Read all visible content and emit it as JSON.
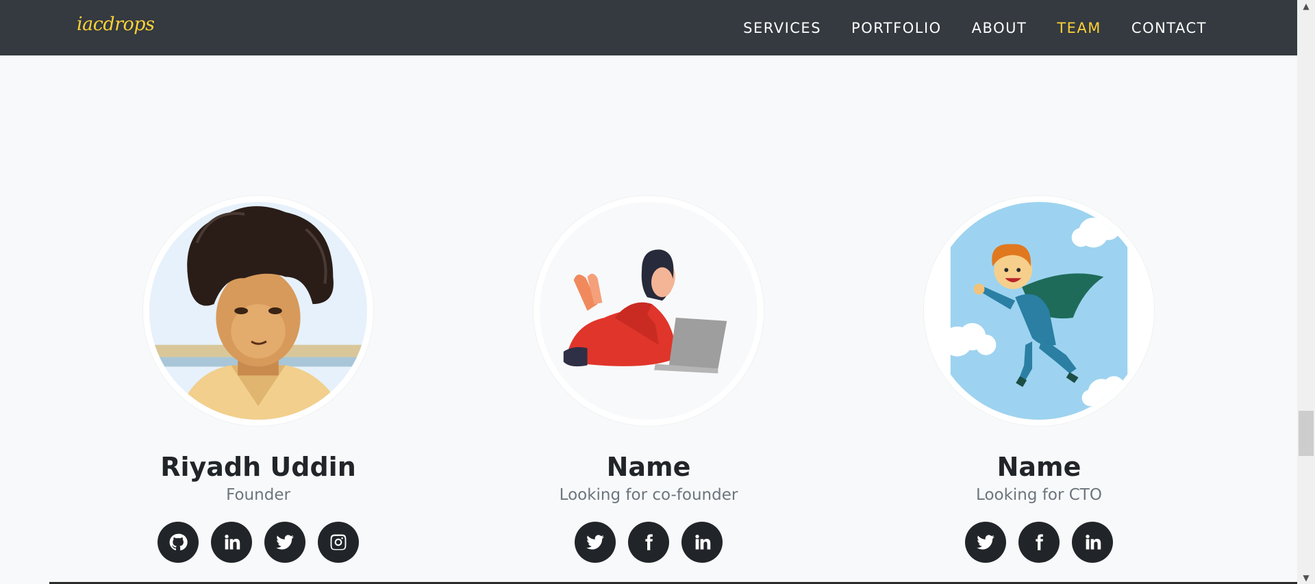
{
  "navbar": {
    "brand": "iacdrops",
    "items": [
      {
        "label": "SERVICES",
        "active": false
      },
      {
        "label": "PORTFOLIO",
        "active": false
      },
      {
        "label": "ABOUT",
        "active": false
      },
      {
        "label": "TEAM",
        "active": true
      },
      {
        "label": "CONTACT",
        "active": false
      }
    ]
  },
  "colors": {
    "navbar_bg": "#343a40",
    "accent": "#fed136",
    "page_bg": "#f8f9fa",
    "social_bg": "#212529"
  },
  "team": [
    {
      "name": "Riyadh Uddin",
      "role": "Founder",
      "avatar": "portrait-photo",
      "social": [
        "github-icon",
        "linkedin-icon",
        "twitter-icon",
        "instagram-icon"
      ]
    },
    {
      "name": "Name",
      "role": "Looking for co-founder",
      "avatar": "woman-with-laptop-illustration",
      "social": [
        "twitter-icon",
        "facebook-icon",
        "linkedin-icon"
      ]
    },
    {
      "name": "Name",
      "role": "Looking for CTO",
      "avatar": "flying-superhero-illustration",
      "social": [
        "twitter-icon",
        "facebook-icon",
        "linkedin-icon"
      ]
    }
  ]
}
